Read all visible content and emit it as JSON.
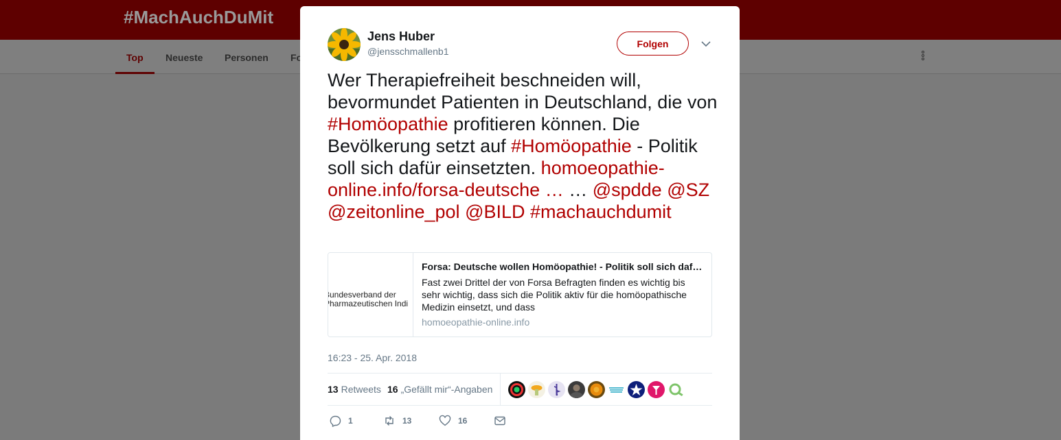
{
  "background": {
    "page_title": "#MachAuchDuMit",
    "tabs": [
      {
        "label": "Top"
      },
      {
        "label": "Neueste"
      },
      {
        "label": "Personen"
      },
      {
        "label": "Fo"
      }
    ]
  },
  "tweet": {
    "author": {
      "name": "Jens Huber",
      "handle": "@jensschmallenb1"
    },
    "follow_label": "Folgen",
    "text": {
      "t1": "Wer Therapiefreiheit beschneiden will, bevormundet Patienten in Deutschland, die von ",
      "h1": "#Homöopathie",
      "t2": " profitieren können. Die Bevölkerung setzt auf ",
      "h2": "#Homöopathie",
      "t3": " - Politik soll sich dafür einsetzten. ",
      "url": "homoeopathie-online.info/forsa-deutsche  …",
      "t4": " … ",
      "m1": "@spdde",
      "m2": "@SZ",
      "m3": "@zeitonline_pol",
      "m4": "@BILD",
      "h3": "#machauchdumit"
    },
    "card": {
      "thumb_text_line1": "Bundesverband der",
      "thumb_text_line2": "Pharmazeutischen Indi",
      "title": "Forsa: Deutsche wollen Homöopathie! - Politik soll sich dafür einsetzen",
      "description": "Fast zwei Drittel der von Forsa Befragten finden es wichtig bis sehr wichtig, dass sich die Politik aktiv für die homöopathische Medizin einsetzt, und dass",
      "domain": "homoeopathie-online.info"
    },
    "timestamp": "16:23 - 25. Apr. 2018",
    "stats": {
      "retweets_count": "13",
      "retweets_label": "Retweets",
      "likes_count": "16",
      "likes_label": "„Gefällt mir“-Angaben"
    },
    "actions": {
      "reply_count": "1",
      "retweet_count": "13",
      "like_count": "16"
    }
  },
  "colors": {
    "accent": "#b10000",
    "header_dimmed": "#5e0000",
    "overlay": "#7b7b7b"
  }
}
